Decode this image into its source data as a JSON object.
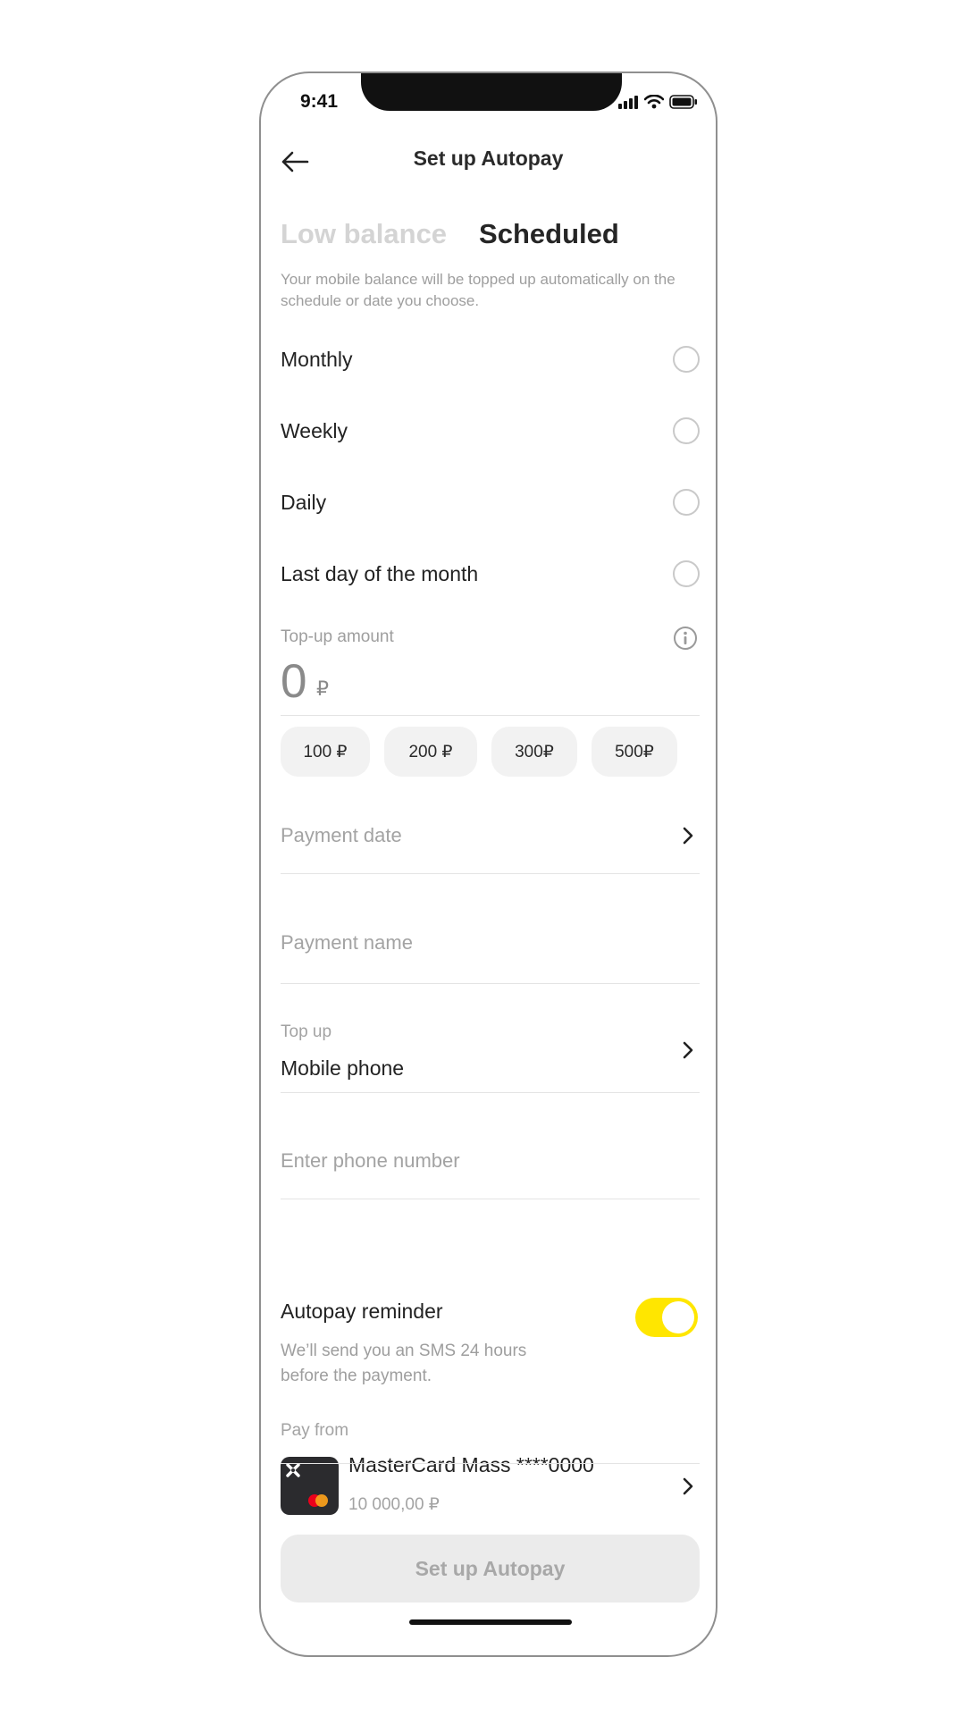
{
  "status_bar": {
    "time": "9:41"
  },
  "header": {
    "title": "Set up Autopay"
  },
  "tabs": [
    {
      "label": "Low balance",
      "active": false
    },
    {
      "label": "Scheduled",
      "active": true
    }
  ],
  "description": "Your mobile balance will be topped up automatically on the schedule or date you choose.",
  "schedule_options": [
    {
      "label": "Monthly",
      "selected": false
    },
    {
      "label": "Weekly",
      "selected": false
    },
    {
      "label": "Daily",
      "selected": false
    },
    {
      "label": "Last day of the month",
      "selected": false
    }
  ],
  "amount": {
    "label": "Top-up amount",
    "value": "0",
    "currency": "₽",
    "presets": [
      "100 ₽",
      "200 ₽",
      "300₽",
      "500₽"
    ]
  },
  "payment_date": {
    "placeholder": "Payment date"
  },
  "payment_name": {
    "placeholder": "Payment name"
  },
  "top_up": {
    "label": "Top up",
    "value": "Mobile phone"
  },
  "phone": {
    "placeholder": "Enter phone number"
  },
  "reminder": {
    "title": "Autopay reminder",
    "description": "We’ll send you an SMS 24 hours before the payment.",
    "enabled": true
  },
  "pay_from": {
    "label": "Pay from",
    "card_name": "MasterCard Mass ****0000",
    "balance": "10 000,00 ₽"
  },
  "cta": {
    "label": "Set up Autopay",
    "enabled": false
  },
  "colors": {
    "accent": "#FFE600",
    "muted_text": "#9E9E9E",
    "chip_bg": "#F2F2F2"
  }
}
